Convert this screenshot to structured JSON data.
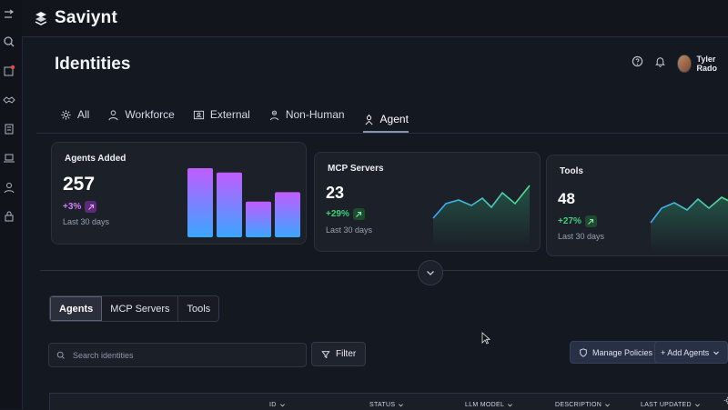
{
  "brand": {
    "name": "Saviynt"
  },
  "rail": {
    "icons": [
      "collapse-arrow-icon",
      "search-icon",
      "alert-icon",
      "handshake-icon",
      "building-icon",
      "laptop-icon",
      "person-icon",
      "lock-icon"
    ]
  },
  "header": {
    "title": "Identities",
    "user_name": "Tyler Rado"
  },
  "tabs": [
    {
      "label": "All",
      "icon": "settings-gear-icon",
      "active": false
    },
    {
      "label": "Workforce",
      "icon": "person-icon",
      "active": false
    },
    {
      "label": "External",
      "icon": "id-card-icon",
      "active": false
    },
    {
      "label": "Non-Human",
      "icon": "robot-person-icon",
      "active": false
    },
    {
      "label": "Agent",
      "icon": "agent-icon",
      "active": true
    }
  ],
  "cards": {
    "agents_added": {
      "title": "Agents Added",
      "value": "257",
      "delta": "+3%",
      "period": "Last 30 days",
      "bars": [
        0.95,
        0.89,
        0.49,
        0.62
      ]
    },
    "mcp_servers": {
      "title": "MCP Servers",
      "value": "23",
      "delta": "+29%",
      "period": "Last 30 days"
    },
    "tools": {
      "title": "Tools",
      "value": "48",
      "delta": "+27%",
      "period": "Last 30 days"
    }
  },
  "segments": [
    {
      "label": "Agents",
      "active": true
    },
    {
      "label": "MCP Servers",
      "active": false
    },
    {
      "label": "Tools",
      "active": false
    }
  ],
  "search": {
    "placeholder": "Search identities"
  },
  "toolbar": {
    "filter_label": "Filter",
    "manage_label": "Manage Policies",
    "add_label": "+ Add Agents"
  },
  "table": {
    "columns": [
      "ID",
      "STATUS",
      "LLM MODEL",
      "DESCRIPTION",
      "LAST UPDATED"
    ]
  },
  "colors": {
    "background": "#141821",
    "card": "#1c2029",
    "positive": "#3fd07a",
    "accent_purple": "#b85cff",
    "accent_blue": "#3ea8ff",
    "button": "#283046"
  }
}
